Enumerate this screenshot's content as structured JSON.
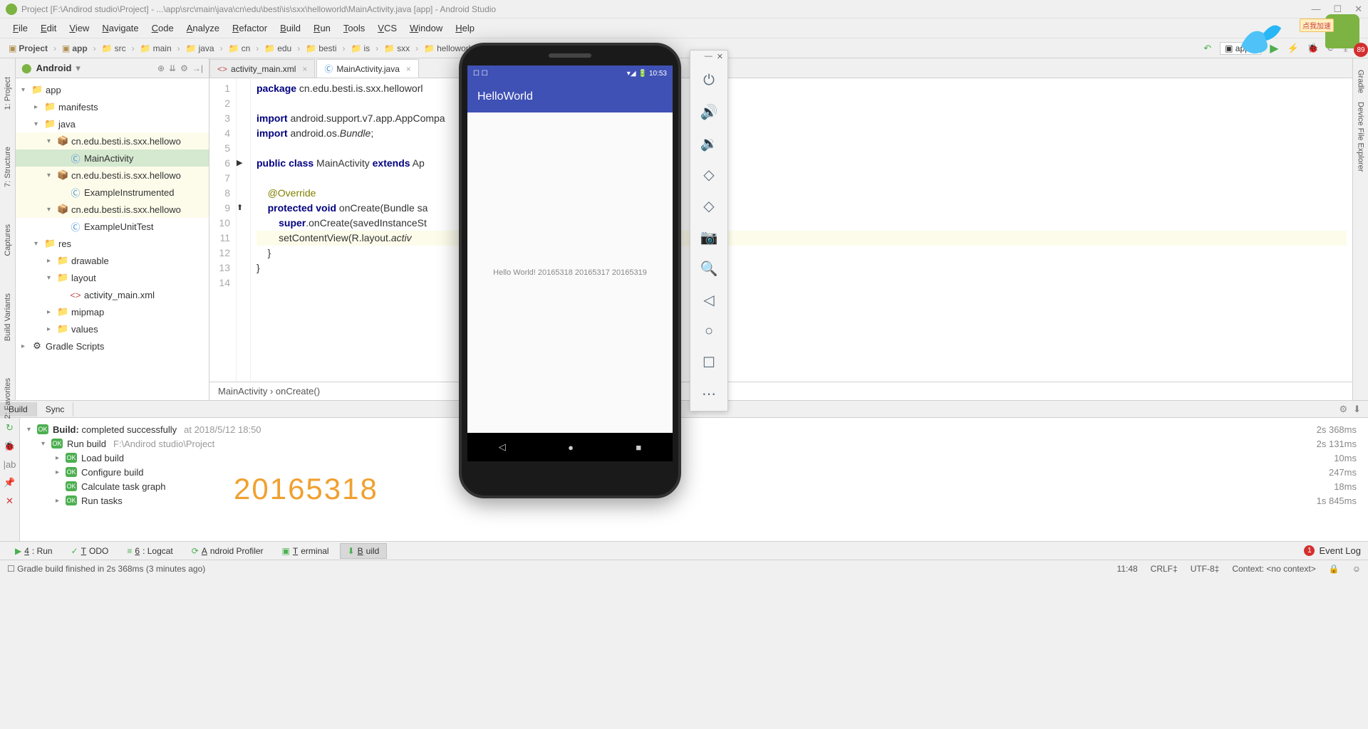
{
  "window": {
    "title": "Project [F:\\Andirod studio\\Project] - ...\\app\\src\\main\\java\\cn\\edu\\besti\\is\\sxx\\helloworld\\MainActivity.java [app] - Android Studio"
  },
  "menu": [
    "File",
    "Edit",
    "View",
    "Navigate",
    "Code",
    "Analyze",
    "Refactor",
    "Build",
    "Run",
    "Tools",
    "VCS",
    "Window",
    "Help"
  ],
  "breadcrumbs": [
    "Project",
    "app",
    "src",
    "main",
    "java",
    "cn",
    "edu",
    "besti",
    "is",
    "sxx",
    "helloworld"
  ],
  "toolbar": {
    "run_config": "app"
  },
  "project": {
    "header": "Android",
    "tree": [
      {
        "depth": 0,
        "arrow": "▾",
        "icon": "📁",
        "cls": "mod",
        "label": "app",
        "hl": false
      },
      {
        "depth": 1,
        "arrow": "▸",
        "icon": "📁",
        "cls": "mod",
        "label": "manifests",
        "hl": false
      },
      {
        "depth": 1,
        "arrow": "▾",
        "icon": "📁",
        "cls": "pkg",
        "label": "java",
        "hl": false
      },
      {
        "depth": 2,
        "arrow": "▾",
        "icon": "📦",
        "cls": "pkg",
        "label": "cn.edu.besti.is.sxx.hellowo",
        "hl": true
      },
      {
        "depth": 3,
        "arrow": "",
        "icon": "Ⓒ",
        "cls": "cls",
        "label": "MainActivity",
        "sel": true
      },
      {
        "depth": 2,
        "arrow": "▾",
        "icon": "📦",
        "cls": "pkg",
        "label": "cn.edu.besti.is.sxx.hellowo",
        "hl": true
      },
      {
        "depth": 3,
        "arrow": "",
        "icon": "Ⓒ",
        "cls": "cls",
        "label": "ExampleInstrumented",
        "hl": true
      },
      {
        "depth": 2,
        "arrow": "▾",
        "icon": "📦",
        "cls": "pkg",
        "label": "cn.edu.besti.is.sxx.hellowo",
        "hl": true
      },
      {
        "depth": 3,
        "arrow": "",
        "icon": "Ⓒ",
        "cls": "cls",
        "label": "ExampleUnitTest",
        "hl": false
      },
      {
        "depth": 1,
        "arrow": "▾",
        "icon": "📁",
        "cls": "mod",
        "label": "res",
        "hl": false
      },
      {
        "depth": 2,
        "arrow": "▸",
        "icon": "📁",
        "cls": "mod",
        "label": "drawable",
        "hl": false
      },
      {
        "depth": 2,
        "arrow": "▾",
        "icon": "📁",
        "cls": "mod",
        "label": "layout",
        "hl": false
      },
      {
        "depth": 3,
        "arrow": "",
        "icon": "<>",
        "cls": "xml",
        "label": "activity_main.xml",
        "hl": false
      },
      {
        "depth": 2,
        "arrow": "▸",
        "icon": "📁",
        "cls": "mod",
        "label": "mipmap",
        "hl": false
      },
      {
        "depth": 2,
        "arrow": "▸",
        "icon": "📁",
        "cls": "mod",
        "label": "values",
        "hl": false
      },
      {
        "depth": 0,
        "arrow": "▸",
        "icon": "⚙",
        "cls": "",
        "label": "Gradle Scripts",
        "hl": false
      }
    ]
  },
  "left_tabs": [
    "1: Project",
    "7: Structure",
    "Captures",
    "Build Variants",
    "2: Favorites"
  ],
  "right_tabs": [
    "Gradle",
    "Device File Explorer"
  ],
  "editor": {
    "tabs": [
      {
        "icon": "<>",
        "label": "activity_main.xml",
        "active": false
      },
      {
        "icon": "Ⓒ",
        "label": "MainActivity.java",
        "active": true
      }
    ],
    "lines": [
      {
        "n": 1,
        "html": "<span class='kw'>package</span> cn.edu.besti.is.sxx.helloworl"
      },
      {
        "n": 2,
        "html": ""
      },
      {
        "n": 3,
        "html": "<span class='kw'>import</span> android.support.v7.app.AppCompa"
      },
      {
        "n": 4,
        "html": "<span class='kw'>import</span> android.os.<span class='it'>Bundle</span>;"
      },
      {
        "n": 5,
        "html": ""
      },
      {
        "n": 6,
        "html": "<span class='kw'>public class</span> MainActivity <span class='kw'>extends</span> Ap"
      },
      {
        "n": 7,
        "html": ""
      },
      {
        "n": 8,
        "html": "    <span class='an'>@Override</span>"
      },
      {
        "n": 9,
        "html": "    <span class='kw'>protected void</span> onCreate(Bundle sa"
      },
      {
        "n": 10,
        "html": "        <span class='kw'>super</span>.onCreate(savedInstanceSt"
      },
      {
        "n": 11,
        "html": "        setContentView(R.layout.<span class='it'>activ</span>",
        "hl": true
      },
      {
        "n": 12,
        "html": "    }"
      },
      {
        "n": 13,
        "html": "}"
      },
      {
        "n": 14,
        "html": ""
      }
    ],
    "crumb": "MainActivity  ›  onCreate()"
  },
  "build_tabs": [
    "Build",
    "Sync"
  ],
  "build": {
    "rows": [
      {
        "depth": 0,
        "arrow": "▾",
        "label": "Build:",
        "bold": "completed successfully",
        "meta": "at 2018/5/12 18:50",
        "time": "2s 368ms"
      },
      {
        "depth": 1,
        "arrow": "▾",
        "label": "Run build",
        "meta": "F:\\Andirod studio\\Project",
        "time": "2s 131ms"
      },
      {
        "depth": 2,
        "arrow": "▸",
        "label": "Load build",
        "time": "10ms"
      },
      {
        "depth": 2,
        "arrow": "▸",
        "label": "Configure build",
        "time": "247ms"
      },
      {
        "depth": 2,
        "arrow": "",
        "label": "Calculate task graph",
        "time": "18ms"
      },
      {
        "depth": 2,
        "arrow": "▸",
        "label": "Run tasks",
        "time": "1s 845ms"
      }
    ],
    "watermark": "20165318"
  },
  "bottom_tabs": [
    {
      "label": "4: Run",
      "icon": "▶"
    },
    {
      "label": "TODO",
      "icon": "✓"
    },
    {
      "label": "6: Logcat",
      "icon": "≡"
    },
    {
      "label": "Android Profiler",
      "icon": "⟳"
    },
    {
      "label": "Terminal",
      "icon": "▣"
    },
    {
      "label": "Build",
      "icon": "⬇",
      "active": true
    }
  ],
  "event_log": {
    "badge": "1",
    "label": "Event Log"
  },
  "status": {
    "msg": "Gradle build finished in 2s 368ms (3 minutes ago)",
    "time": "11:48",
    "le": "CRLF‡",
    "enc": "UTF-8‡",
    "ctx": "Context: <no context>"
  },
  "emulator": {
    "clock": "10:53",
    "app_title": "HelloWorld",
    "body_text": "Hello World! 20165318 20165317 20165319",
    "controls": [
      "⏻",
      "🔊",
      "🔉",
      "◇",
      "◇",
      "📷",
      "🔍",
      "◁",
      "○",
      "☐",
      "⋯"
    ]
  },
  "overlay": {
    "tag": "点我加速",
    "android_badge": "89"
  }
}
